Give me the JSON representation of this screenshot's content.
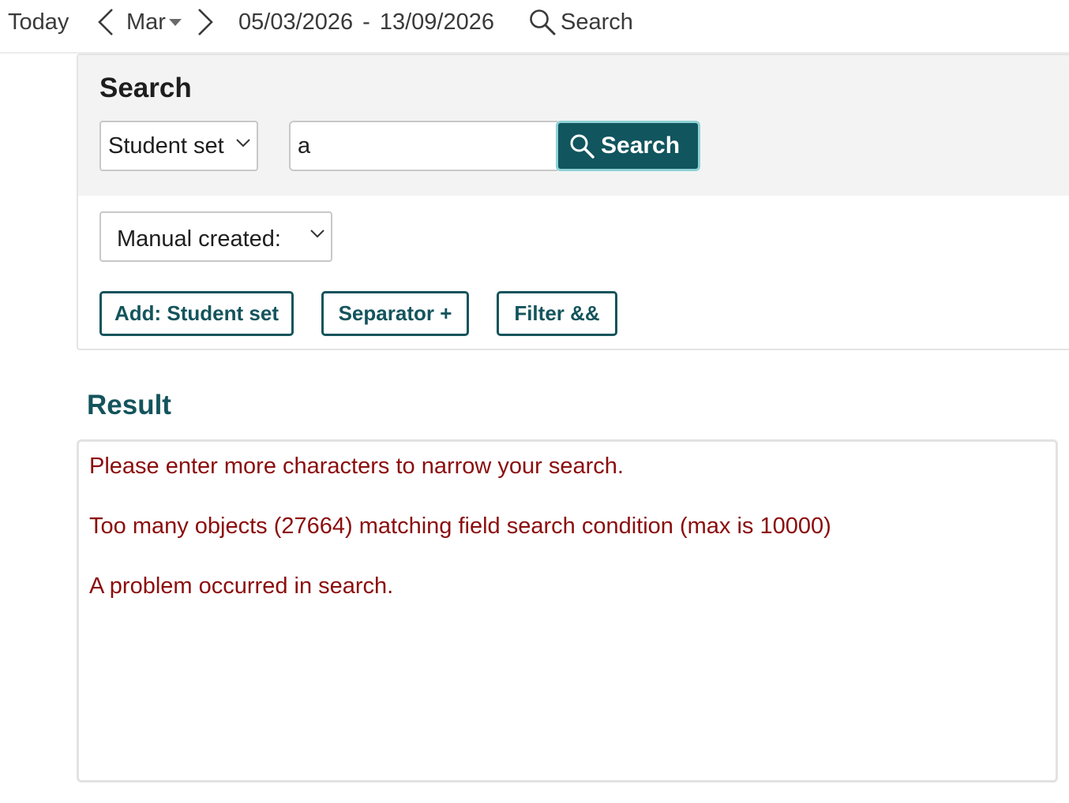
{
  "topbar": {
    "today_label": "Today",
    "prev_icon": "chevron-left-icon",
    "month_label": "Mar",
    "month_caret_icon": "caret-down-icon",
    "next_icon": "chevron-right-icon",
    "range_start": "05/03/2026",
    "range_separator": "-",
    "range_end": "13/09/2026",
    "search_icon": "search-icon",
    "search_label": "Search"
  },
  "search_panel": {
    "title": "Search",
    "type_select": {
      "value": "Student set",
      "icon": "chevron-down-icon"
    },
    "query_input": {
      "value": "a",
      "placeholder": ""
    },
    "search_button": {
      "label": "Search",
      "icon": "search-icon"
    },
    "manual_select": {
      "value": "Manual created:",
      "icon": "chevron-down-icon"
    },
    "actions": {
      "add_label": "Add: Student set",
      "separator_label": "Separator +",
      "filter_label": "Filter &&"
    }
  },
  "result": {
    "title": "Result",
    "messages": [
      "Please enter more characters to narrow your search.",
      "Too many objects (27664) matching field search condition (max is 10000)",
      "A problem occurred in search."
    ]
  },
  "colors": {
    "accent": "#14545c",
    "search_button_bg": "#11555e",
    "error_text": "#8b0d0d",
    "panel_header_bg": "#f3f3f3"
  }
}
